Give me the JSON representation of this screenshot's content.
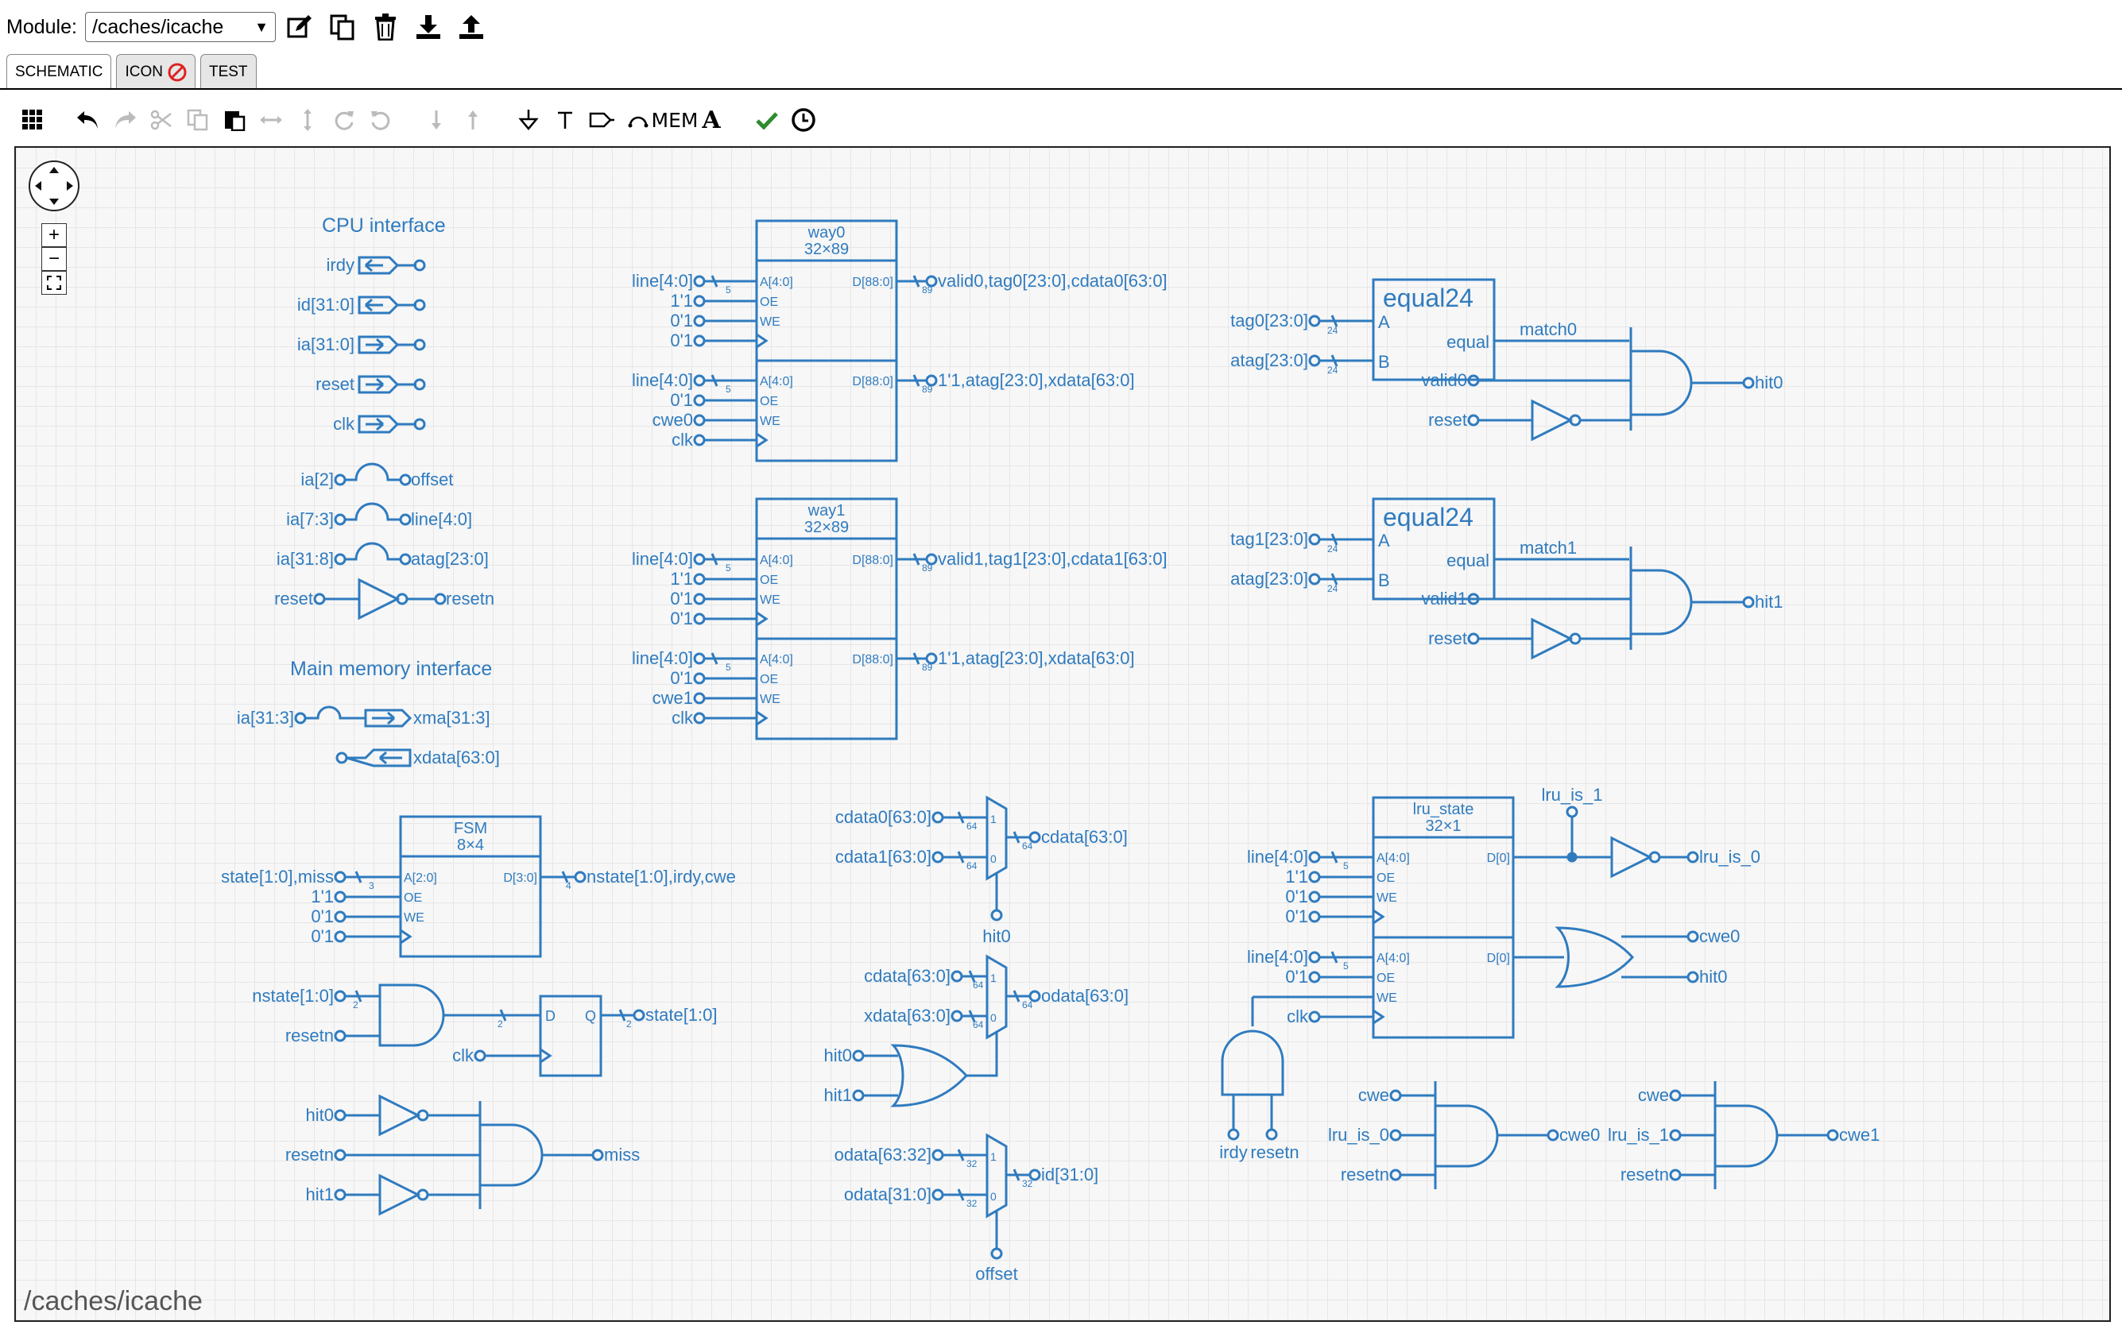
{
  "header": {
    "module_label": "Module:",
    "module_value": "/caches/icache",
    "icons": [
      "edit-icon",
      "copy-icon",
      "trash-icon",
      "download-icon",
      "upload-icon"
    ]
  },
  "tabs": [
    {
      "label": "SCHEMATIC",
      "active": true
    },
    {
      "label": "ICON",
      "active": false,
      "badge": "no-entry-icon"
    },
    {
      "label": "TEST",
      "active": false
    }
  ],
  "toolbar": {
    "mem_label": "MEM",
    "text_label": "A",
    "icons": [
      "grid-icon",
      "undo-icon",
      "redo-icon",
      "cut-icon",
      "copy-icon",
      "paste-icon",
      "flip-h-icon",
      "flip-v-icon",
      "rotate-cw-icon",
      "rotate-ccw-icon",
      "move-down-icon",
      "move-up-icon",
      "ground-icon",
      "vdd-icon",
      "port-icon",
      "jumper-icon",
      "check-icon",
      "clock-icon"
    ]
  },
  "colors": {
    "wire": "#2f7bbf",
    "check": "#2e8b2e",
    "no_entry": "#dd2222"
  },
  "canvas": {
    "footer_path": "/caches/icache",
    "zoom": {
      "in": "+",
      "out": "−"
    }
  },
  "schematic": {
    "cpu": {
      "title": "CPU interface",
      "ports": [
        "irdy",
        "id[31:0]",
        "ia[31:0]",
        "reset",
        "clk"
      ],
      "jumpers": [
        [
          "ia[2]",
          "offset"
        ],
        [
          "ia[7:3]",
          "line[4:0]"
        ],
        [
          "ia[31:8]",
          "atag[23:0]"
        ]
      ],
      "inv": [
        "reset",
        "resetn"
      ]
    },
    "mem": {
      "title": "Main memory interface",
      "xma_in": "ia[31:3]",
      "xma_out": "xma[31:3]",
      "xdata": "xdata[63:0]"
    },
    "way0": {
      "title": "way0",
      "size": "32×89",
      "p1": {
        "a": "A[4:0]",
        "oe": "OE",
        "we": "WE",
        "d": "D[88:0]",
        "in_a": "line[4:0]",
        "in_oe": "1'1",
        "in_we": "0'1",
        "in_clk": "0'1",
        "out": "valid0,tag0[23:0],cdata0[63:0]",
        "w_a": "5",
        "w_d": "89"
      },
      "p2": {
        "a": "A[4:0]",
        "oe": "OE",
        "we": "WE",
        "d": "D[88:0]",
        "in_a": "line[4:0]",
        "in_oe": "0'1",
        "in_we": "cwe0",
        "in_clk": "clk",
        "out": "1'1,atag[23:0],xdata[63:0]",
        "w_a": "5",
        "w_d": "89"
      }
    },
    "way1": {
      "title": "way1",
      "size": "32×89",
      "p1": {
        "a": "A[4:0]",
        "oe": "OE",
        "we": "WE",
        "d": "D[88:0]",
        "in_a": "line[4:0]",
        "in_oe": "1'1",
        "in_we": "0'1",
        "in_clk": "0'1",
        "out": "valid1,tag1[23:0],cdata1[63:0]",
        "w_a": "5",
        "w_d": "89"
      },
      "p2": {
        "a": "A[4:0]",
        "oe": "OE",
        "we": "WE",
        "d": "D[88:0]",
        "in_a": "line[4:0]",
        "in_oe": "0'1",
        "in_we": "cwe1",
        "in_clk": "clk",
        "out": "1'1,atag[23:0],xdata[63:0]",
        "w_a": "5",
        "w_d": "89"
      }
    },
    "eq0": {
      "title": "equal24",
      "a": "A",
      "b": "B",
      "out": "equal",
      "in_a": "tag0[23:0]",
      "in_b": "atag[23:0]",
      "w": "24",
      "match": "match0",
      "valid": "valid0",
      "reset": "reset",
      "hit": "hit0"
    },
    "eq1": {
      "title": "equal24",
      "a": "A",
      "b": "B",
      "out": "equal",
      "in_a": "tag1[23:0]",
      "in_b": "atag[23:0]",
      "w": "24",
      "match": "match1",
      "valid": "valid1",
      "reset": "reset",
      "hit": "hit1"
    },
    "fsm": {
      "title": "FSM",
      "size": "8×4",
      "a": "A[2:0]",
      "d": "D[3:0]",
      "oe": "OE",
      "we": "WE",
      "in_a": "state[1:0],miss",
      "in_oe": "1'1",
      "in_we": "0'1",
      "in_clk": "0'1",
      "out": "nstate[1:0],irdy,cwe",
      "w_a": "3",
      "w_d": "4"
    },
    "dff": {
      "in_a": "nstate[1:0]",
      "in_b": "resetn",
      "clk": "clk",
      "d": "D",
      "q": "Q",
      "out": "state[1:0]",
      "w": "2"
    },
    "miss": {
      "in": [
        "hit0",
        "resetn",
        "hit1"
      ],
      "out": "miss"
    },
    "mux1": {
      "in0": "cdata0[63:0]",
      "in1": "cdata1[63:0]",
      "out": "cdata[63:0]",
      "sel": "hit0",
      "w": "64",
      "one": "1",
      "zero": "0"
    },
    "mux2": {
      "in0": "cdata[63:0]",
      "in1": "xdata[63:0]",
      "out": "odata[63:0]",
      "sel_a": "hit0",
      "sel_b": "hit1",
      "w": "64",
      "one": "1",
      "zero": "0"
    },
    "mux3": {
      "in0": "odata[63:32]",
      "in1": "odata[31:0]",
      "out": "id[31:0]",
      "sel": "offset",
      "w": "32",
      "one": "1",
      "zero": "0"
    },
    "lru": {
      "title": "lru_state",
      "size": "32×1",
      "p1": {
        "a": "A[4:0]",
        "oe": "OE",
        "we": "WE",
        "d": "D[0]",
        "in_a": "line[4:0]",
        "in_oe": "1'1",
        "in_we": "0'1",
        "in_clk": "0'1",
        "w": "5"
      },
      "p2": {
        "a": "A[4:0]",
        "oe": "OE",
        "we": "WE",
        "d": "D[0]",
        "in_a": "line[4:0]",
        "in_oe": "0'1",
        "in_clk": "clk",
        "w": "5"
      },
      "is1": "lru_is_1",
      "is0": "lru_is_0",
      "or_out1": "cwe0",
      "or_out2": "hit0",
      "and_in": [
        "irdy",
        "resetn"
      ]
    },
    "cwe0": {
      "in": [
        "cwe",
        "lru_is_0",
        "resetn"
      ],
      "out": "cwe0"
    },
    "cwe1": {
      "in": [
        "cwe",
        "lru_is_1",
        "resetn"
      ],
      "out": "cwe1"
    }
  }
}
